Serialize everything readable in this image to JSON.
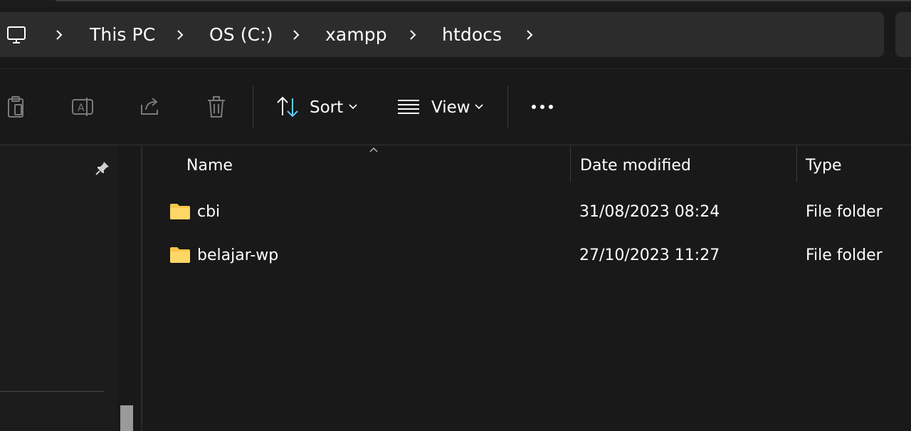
{
  "breadcrumb": {
    "items": [
      "This PC",
      "OS (C:)",
      "xampp",
      "htdocs"
    ]
  },
  "toolbar": {
    "sort_label": "Sort",
    "view_label": "View"
  },
  "columns": {
    "name": "Name",
    "date_modified": "Date modified",
    "type": "Type"
  },
  "files": [
    {
      "name": "cbi",
      "date_modified": "31/08/2023 08:24",
      "type": "File folder"
    },
    {
      "name": "belajar-wp",
      "date_modified": "27/10/2023 11:27",
      "type": "File folder"
    }
  ],
  "colors": {
    "background": "#191919",
    "toolbar_accent": "#60cdff",
    "folder": "#f8c74a"
  },
  "icons": [
    "this-pc-icon",
    "chevron-right-icon",
    "paste-icon",
    "rename-icon",
    "share-icon",
    "delete-icon",
    "sort-icon",
    "view-icon",
    "more-options-icon",
    "pin-icon",
    "folder-icon",
    "sort-indicator-icon",
    "chevron-down-icon"
  ]
}
